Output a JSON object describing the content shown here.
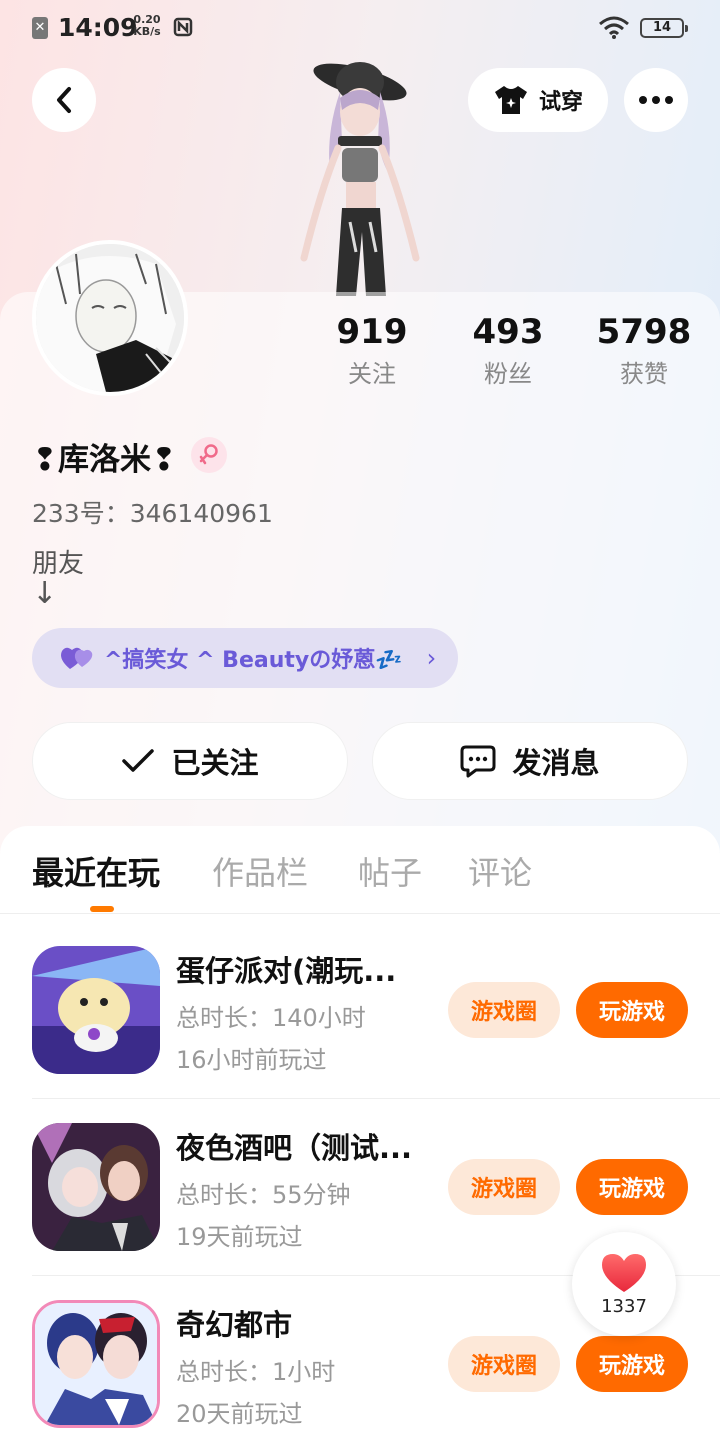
{
  "status_bar": {
    "time": "14:09",
    "speed_value": "0.20",
    "speed_unit": "KB/s",
    "battery": "14"
  },
  "header": {
    "tryon_label": "试穿"
  },
  "profile": {
    "stats": [
      {
        "value": "919",
        "label": "关注"
      },
      {
        "value": "493",
        "label": "粉丝"
      },
      {
        "value": "5798",
        "label": "获赞"
      }
    ],
    "nickname": "❢库洛米❢",
    "uid": "233号：346140961",
    "bio_line1": "朋友",
    "bio_line2": "↓",
    "group_chip": "^搞笑女 ^ Beautyの妤蒽💤",
    "follow_label": "已关注",
    "message_label": "发消息"
  },
  "tabs": [
    "最近在玩",
    "作品栏",
    "帖子",
    "评论"
  ],
  "games": [
    {
      "title": "蛋仔派对(潮玩...",
      "duration": "总时长：140小时",
      "last_played": "16小时前玩过",
      "circle_label": "游戏圈",
      "play_label": "玩游戏"
    },
    {
      "title": "夜色酒吧（测试...",
      "duration": "总时长：55分钟",
      "last_played": "19天前玩过",
      "circle_label": "游戏圈",
      "play_label": "玩游戏"
    },
    {
      "title": "奇幻都市",
      "duration": "总时长：1小时",
      "last_played": "20天前玩过",
      "circle_label": "游戏圈",
      "play_label": "玩游戏"
    }
  ],
  "like_fab": {
    "count": "1337"
  },
  "colors": {
    "accent": "#ff6a00",
    "chip_text": "#6a5ad8",
    "chip_bg": "#e2dff3"
  }
}
